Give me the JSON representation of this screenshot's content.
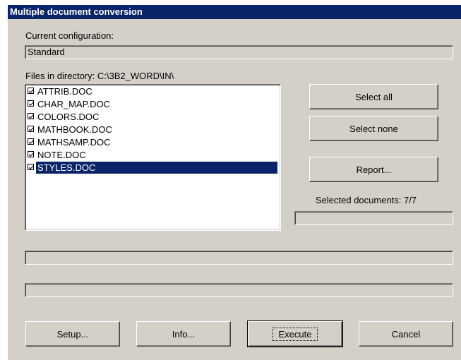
{
  "window": {
    "title": "Multiple document conversion"
  },
  "config": {
    "label": "Current configuration:",
    "value": "Standard"
  },
  "files": {
    "label": "Files in directory: C:\\3B2_WORD\\IN\\",
    "items": [
      {
        "name": "ATTRIB.DOC",
        "checked": true,
        "selected": false
      },
      {
        "name": "CHAR_MAP.DOC",
        "checked": true,
        "selected": false
      },
      {
        "name": "COLORS.DOC",
        "checked": true,
        "selected": false
      },
      {
        "name": "MATHBOOK.DOC",
        "checked": true,
        "selected": false
      },
      {
        "name": "MATHSAMP.DOC",
        "checked": true,
        "selected": false
      },
      {
        "name": "NOTE.DOC",
        "checked": true,
        "selected": false
      },
      {
        "name": "STYLES.DOC",
        "checked": true,
        "selected": true
      }
    ]
  },
  "buttons": {
    "select_all": "Select all",
    "select_none": "Select none",
    "report": "Report...",
    "setup": "Setup...",
    "info": "Info...",
    "execute": "Execute",
    "cancel": "Cancel"
  },
  "status": {
    "selected_documents": "Selected documents: 7/7"
  },
  "colors": {
    "titlebar": "#0a246a",
    "dialog_bg": "#d4d0c8",
    "selection": "#0a246a"
  }
}
